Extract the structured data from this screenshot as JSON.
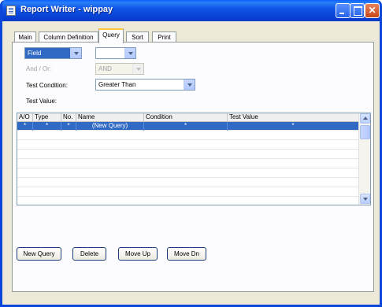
{
  "window": {
    "title": "Report Writer - wippay"
  },
  "tabs": [
    {
      "label": "Main"
    },
    {
      "label": "Column Definition"
    },
    {
      "label": "Query"
    },
    {
      "label": "Sort"
    },
    {
      "label": "Print"
    }
  ],
  "query_form": {
    "field_combo_value": "Field",
    "and_or_label": "And / Or:",
    "and_or_value": "AND",
    "test_condition_label": "Test Condition:",
    "test_condition_value": "Greater Than",
    "test_value_label": "Test Value:"
  },
  "grid": {
    "columns": [
      "A/O",
      "Type",
      "No.",
      "Name",
      "Condition",
      "Test Value"
    ],
    "rows": [
      {
        "ao": "*",
        "type": "*",
        "no": "*",
        "name": "(New Query)",
        "condition": "*",
        "test_value": "*"
      }
    ]
  },
  "buttons": {
    "new_query": "New Query",
    "delete": "Delete",
    "move_up": "Move Up",
    "move_dn": "Move Dn"
  },
  "colors": {
    "titlebar": "#0a46d8",
    "selection": "#316ac5",
    "tab_highlight": "#ffc83c"
  }
}
